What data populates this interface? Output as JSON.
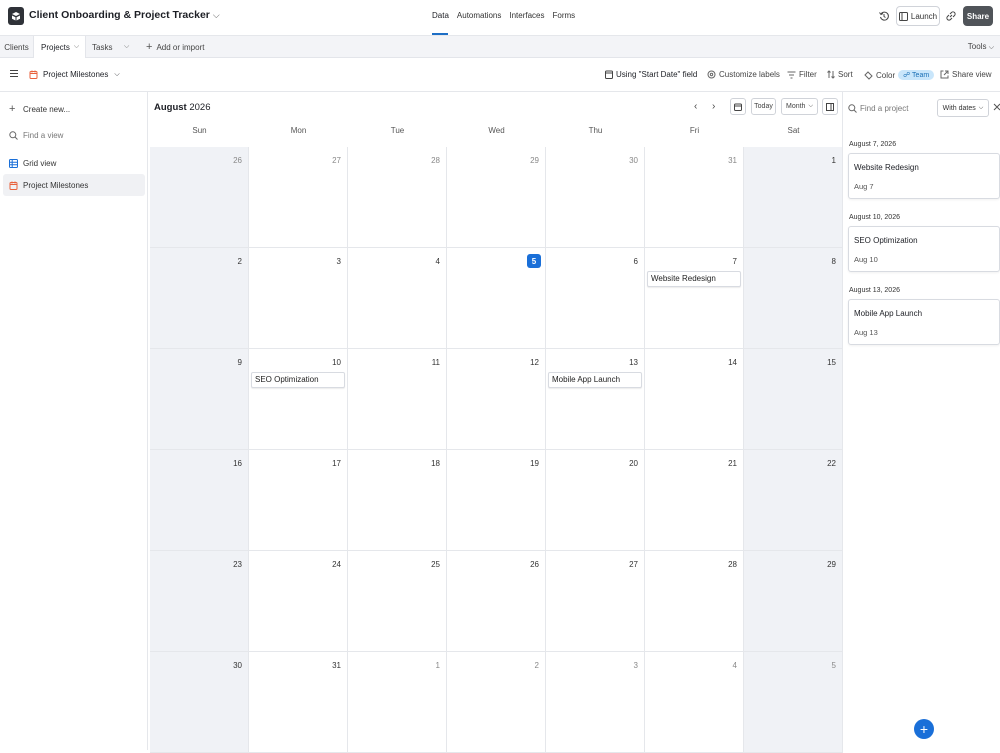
{
  "app": {
    "title": "Client Onboarding & Project Tracker",
    "nav": [
      "Data",
      "Automations",
      "Interfaces",
      "Forms"
    ],
    "active_nav": "Data",
    "launch_label": "Launch",
    "share_label": "Share"
  },
  "tabs": {
    "items": [
      "Clients",
      "Projects",
      "Tasks"
    ],
    "active": "Projects",
    "add_label": "Add or import",
    "tools_label": "Tools"
  },
  "viewbar": {
    "view_name": "Project Milestones",
    "date_field": "Using \"Start Date\" field",
    "customize": "Customize labels",
    "filter": "Filter",
    "sort": "Sort",
    "color": "Color",
    "team": "Team",
    "share_view": "Share view"
  },
  "sidebar": {
    "create_new": "Create new...",
    "find_placeholder": "Find a view",
    "views": [
      {
        "label": "Grid view",
        "icon": "grid-icon"
      },
      {
        "label": "Project Milestones",
        "icon": "calendar-icon"
      }
    ],
    "selected": "Project Milestones"
  },
  "calendar": {
    "month": "August",
    "year": "2026",
    "today_label": "Today",
    "range_label": "Month",
    "weekdays": [
      "Sun",
      "Mon",
      "Tue",
      "Wed",
      "Thu",
      "Fri",
      "Sat"
    ],
    "weeks": [
      [
        "26",
        "27",
        "28",
        "29",
        "30",
        "31",
        "1"
      ],
      [
        "2",
        "3",
        "4",
        "5",
        "6",
        "7",
        "8"
      ],
      [
        "9",
        "10",
        "11",
        "12",
        "13",
        "14",
        "15"
      ],
      [
        "16",
        "17",
        "18",
        "19",
        "20",
        "21",
        "22"
      ],
      [
        "23",
        "24",
        "25",
        "26",
        "27",
        "28",
        "29"
      ],
      [
        "30",
        "31",
        "1",
        "2",
        "3",
        "4",
        "5"
      ]
    ],
    "today": "5",
    "events": [
      {
        "day": "7",
        "title": "Website Redesign"
      },
      {
        "day": "10",
        "title": "SEO Optimization"
      },
      {
        "day": "13",
        "title": "Mobile App Launch"
      }
    ]
  },
  "right_panel": {
    "search_placeholder": "Find a project",
    "filter_label": "With dates",
    "groups": [
      {
        "date": "August 7, 2026",
        "title": "Website Redesign",
        "short": "Aug 7"
      },
      {
        "date": "August 10, 2026",
        "title": "SEO Optimization",
        "short": "Aug 10"
      },
      {
        "date": "August 13, 2026",
        "title": "Mobile App Launch",
        "short": "Aug 13"
      }
    ]
  },
  "colors": {
    "accent": "#1a6fd8",
    "weekend_bg": "#f0f2f6",
    "team_pill": "#c9e6fb"
  }
}
